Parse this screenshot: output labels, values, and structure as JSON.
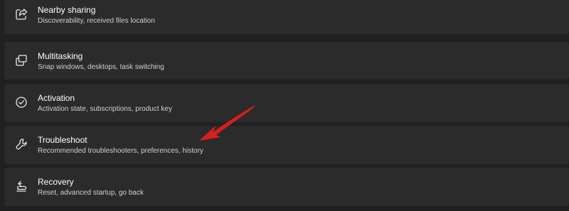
{
  "settings": {
    "items": [
      {
        "title": "Nearby sharing",
        "description": "Discoverability, received files location",
        "icon": "share-icon"
      },
      {
        "title": "Multitasking",
        "description": "Snap windows, desktops, task switching",
        "icon": "multitasking-icon"
      },
      {
        "title": "Activation",
        "description": "Activation state, subscriptions, product key",
        "icon": "checkmark-circle-icon"
      },
      {
        "title": "Troubleshoot",
        "description": "Recommended troubleshooters, preferences, history",
        "icon": "wrench-icon"
      },
      {
        "title": "Recovery",
        "description": "Reset, advanced startup, go back",
        "icon": "recovery-icon"
      }
    ]
  },
  "colors": {
    "page_background": "#202020",
    "row_background": "#2b2b2b",
    "title_text": "#ffffff",
    "description_text": "#cfcfcf",
    "annotation_arrow": "#d81e1e"
  }
}
